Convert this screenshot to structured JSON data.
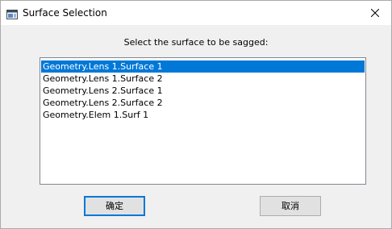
{
  "window": {
    "title": "Surface Selection",
    "app_icon": "application-window-icon",
    "close_icon": "close-icon"
  },
  "dialog": {
    "prompt": "Select the surface to be sagged:",
    "surfaces": [
      "Geometry.Lens 1.Surface 1",
      "Geometry.Lens 1.Surface 2",
      "Geometry.Lens 2.Surface 1",
      "Geometry.Lens 2.Surface 2",
      "Geometry.Elem 1.Surf 1"
    ],
    "selected_surface": "Geometry.Lens 1.Surface 1",
    "ok_label": "确定",
    "cancel_label": "取消"
  },
  "colors": {
    "selection": "#0078d7",
    "dialog_background": "#f0f0f0",
    "button_face": "#e1e1e1"
  }
}
